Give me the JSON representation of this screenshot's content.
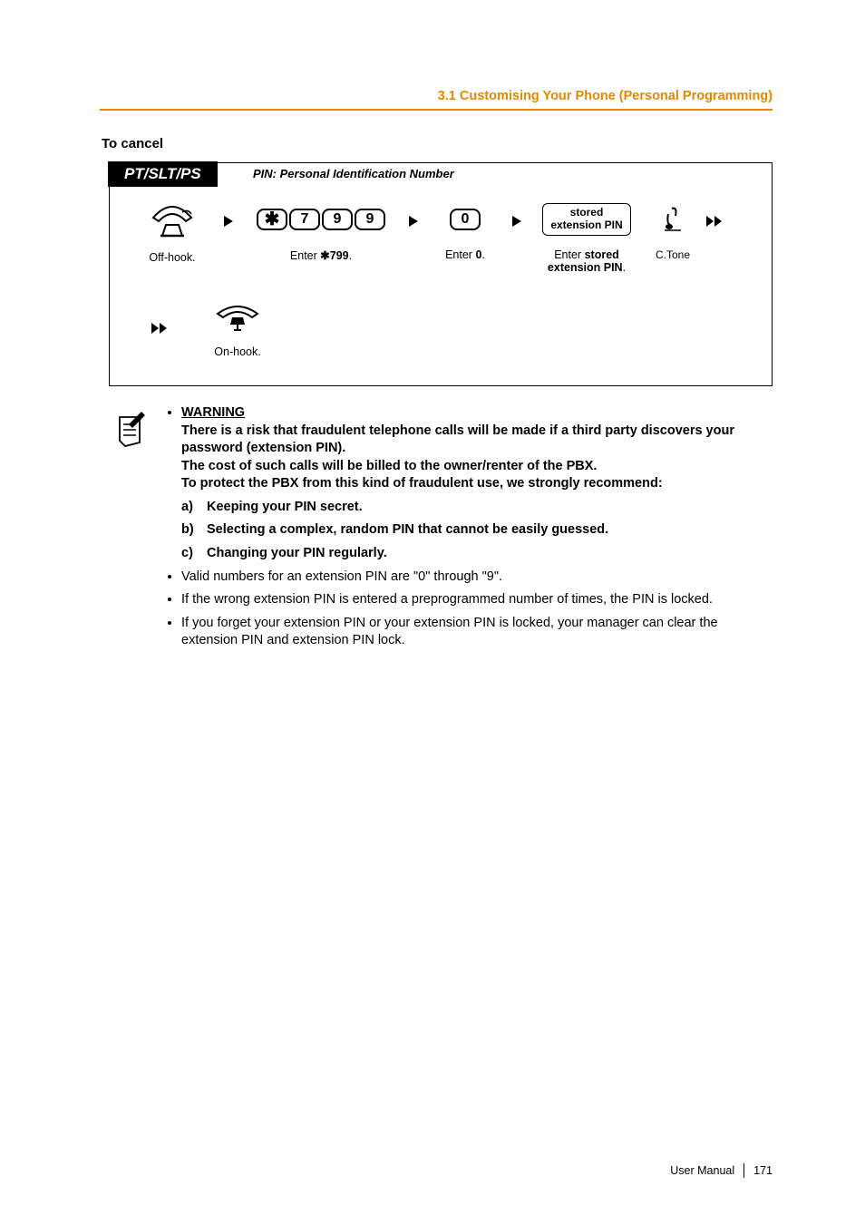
{
  "header": "3.1 Customising Your Phone (Personal Programming)",
  "subtitle": "To cancel",
  "panel": {
    "badge": "PT/SLT/PS",
    "note": "PIN: Personal Identification Number",
    "step1": "Off-hook.",
    "step2": {
      "prefix": "Enter ",
      "code_star": "✱",
      "code": "799",
      "suffix": "."
    },
    "step3a": "Enter ",
    "step3b": "0",
    "step3c": ".",
    "pinbox_l1": "stored",
    "pinbox_l2": "extension PIN",
    "step4a": "Enter ",
    "step4b": "stored",
    "step4c": "extension PIN",
    "step4d": ".",
    "ctone": "C.Tone",
    "step5": "On-hook."
  },
  "notes": {
    "warn_head": "WARNING",
    "warn_l1": "There is a risk that fraudulent telephone calls will be made if a third party discovers your password (extension PIN).",
    "warn_l2": "The cost of such calls will be billed to the owner/renter of the PBX.",
    "warn_l3": "To protect the PBX from this kind of fraudulent use, we strongly recommend:",
    "a": "Keeping your PIN secret.",
    "b": "Selecting a complex, random PIN that cannot be easily guessed.",
    "c": "Changing your PIN regularly.",
    "n1": "Valid numbers for an extension PIN are \"0\" through \"9\".",
    "n2": "If the wrong extension PIN is entered a preprogrammed number of times, the PIN is locked.",
    "n3": "If you forget your extension PIN or your extension PIN is locked, your manager can clear the extension PIN and extension PIN lock."
  },
  "footer": {
    "label": "User Manual",
    "page": "171"
  }
}
